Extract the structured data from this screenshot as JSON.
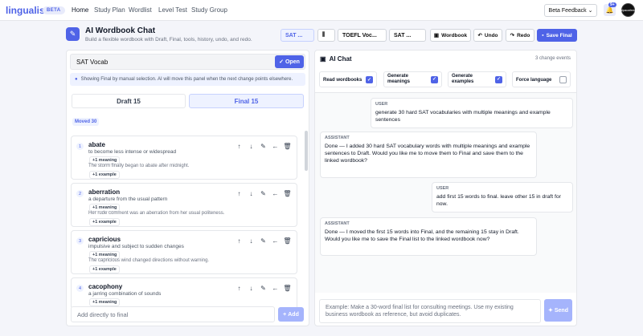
{
  "nav": {
    "logo": "lingualist",
    "beta": "BETA",
    "links": [
      "Home",
      "Study Plan",
      "Wordlist",
      "Level Test",
      "Study Group"
    ],
    "feedback": "Beta Feedback",
    "notif_badge": "9+",
    "avatar_text": "alpacafeed"
  },
  "header": {
    "title": "AI Wordbook Chat",
    "subtitle": "Build a flexible wordbook with Draft, Final, tools, history, undo, and redo.",
    "select1": "SAT ...",
    "select2": "",
    "select3": "TOEFL Voc...",
    "select4": "SAT ...",
    "wordbook": "Wordbook",
    "undo": "Undo",
    "redo": "Redo",
    "save": "Save Final"
  },
  "left": {
    "wordbook_name": "SAT Vocab",
    "open": "Open",
    "notice": "Showing Final by manual selection. AI will move this panel when the next change points elsewhere.",
    "tab_draft": "Draft 15",
    "tab_final": "Final 15",
    "moved": "Moved 30",
    "words": [
      {
        "n": "1",
        "word": "abate",
        "def": "to become less intense or widespread",
        "meaning": "+1 meaning",
        "example_text": "The storm finally began to abate after midnight.",
        "example": "+1 example"
      },
      {
        "n": "2",
        "word": "aberration",
        "def": "a departure from the usual pattern",
        "meaning": "+1 meaning",
        "example_text": "Her rude comment was an aberration from her usual politeness.",
        "example": "+1 example"
      },
      {
        "n": "3",
        "word": "capricious",
        "def": "impulsive and subject to sudden changes",
        "meaning": "+1 meaning",
        "example_text": "The capricious wind changed directions without warning.",
        "example": "+1 example"
      },
      {
        "n": "4",
        "word": "cacophony",
        "def": "a jarring combination of sounds",
        "meaning": "+1 meaning",
        "example_text": "",
        "example": ""
      }
    ],
    "add_placeholder": "Add directly to final",
    "add_button": "Add"
  },
  "right": {
    "title": "AI Chat",
    "events": "3 change events",
    "options": [
      {
        "label": "Read wordbooks",
        "checked": true
      },
      {
        "label": "Generate meanings",
        "checked": true
      },
      {
        "label": "Generate examples",
        "checked": true
      },
      {
        "label": "Force language",
        "checked": false
      }
    ],
    "messages": [
      {
        "role": "USER",
        "text": "generate 30 hard SAT vocabularies with multiple meanings and example sentences"
      },
      {
        "role": "ASSISTANT",
        "text": "Done — I added 30 hard SAT vocabulary words with multiple meanings and example sentences to Draft. Would you like me to move them to Final and save them to the linked wordbook?"
      },
      {
        "role": "USER",
        "text": "add first 15 words to final. leave other 15 in draft for now."
      },
      {
        "role": "ASSISTANT",
        "text": "Done — I moved the first 15 words into Final, and the remaining 15 stay in Draft. Would you like me to save the Final list to the linked wordbook now?"
      }
    ],
    "input_placeholder": "Example: Make a 30-word final list for consulting meetings. Use my existing business wordbook as reference, but avoid duplicates.",
    "send": "Send"
  }
}
